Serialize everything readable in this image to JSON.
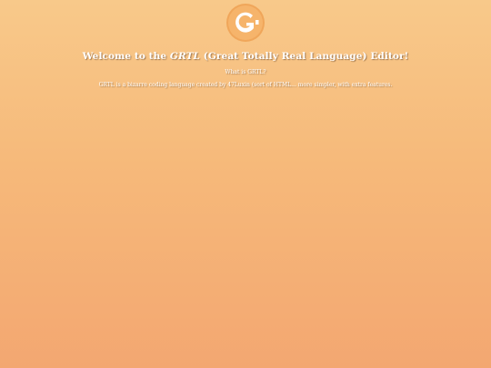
{
  "logo": {
    "icon": "grtl-logo-icon",
    "letter": "G",
    "colors": {
      "outer": "#f0a65a",
      "inner": "#ffffff",
      "accent": "#f4b86e"
    }
  },
  "header": {
    "title_prefix": "Welcome to the ",
    "title_brand": "GRTL",
    "title_suffix": " (Great Totally Real Language) Editor!"
  },
  "subtitle": "What is GRTL?",
  "description": "GRTL is a bizarre coding language created by 47Luxin (sort of HTML... more simpler, with extra features."
}
